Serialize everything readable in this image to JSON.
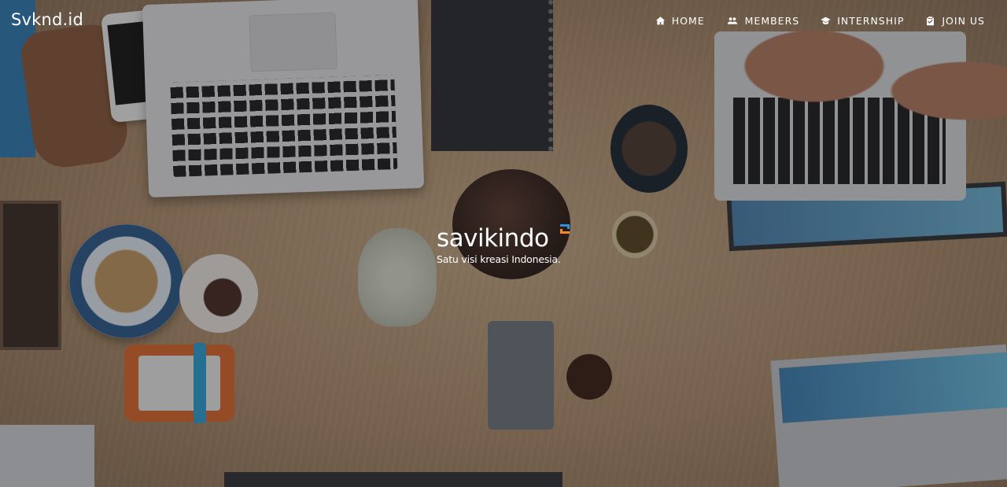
{
  "navbar": {
    "brand": "Svknd.id",
    "items": [
      {
        "label": "HOME",
        "icon": "home-icon"
      },
      {
        "label": "MEMBERS",
        "icon": "users-icon"
      },
      {
        "label": "INTERNSHIP",
        "icon": "graduation-cap-icon"
      },
      {
        "label": "JOIN US",
        "icon": "clipboard-check-icon"
      }
    ]
  },
  "hero": {
    "logo_text": "savikindo",
    "tagline": "Satu visi kreasi Indonesia."
  },
  "colors": {
    "nav_text": "#ffffff",
    "logo_accent_orange": "#f08a24",
    "logo_accent_blue": "#2f8fd8"
  }
}
